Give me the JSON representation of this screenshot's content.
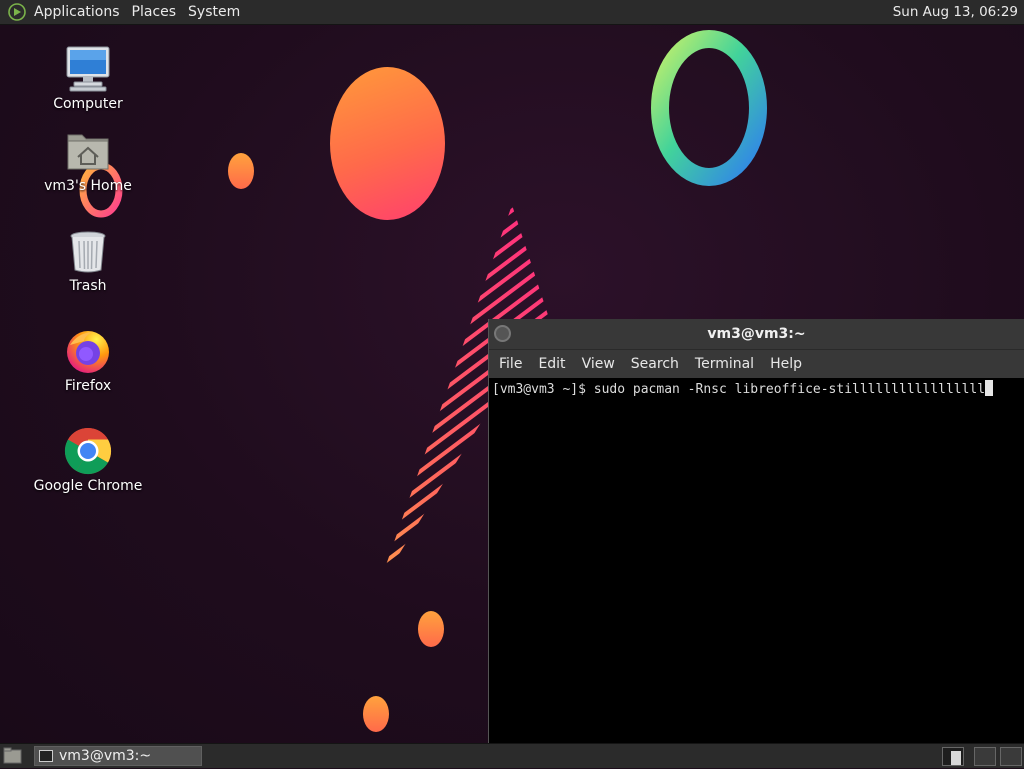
{
  "top_panel": {
    "menus": [
      "Applications",
      "Places",
      "System"
    ],
    "clock": "Sun Aug 13, 06:29"
  },
  "desktop": {
    "icons": [
      {
        "label": "Computer",
        "icon": "computer-icon"
      },
      {
        "label": "vm3's Home",
        "icon": "home-folder-icon"
      },
      {
        "label": "Trash",
        "icon": "trash-icon"
      },
      {
        "label": "Firefox",
        "icon": "firefox-icon"
      },
      {
        "label": "Google Chrome",
        "icon": "chrome-icon"
      }
    ]
  },
  "terminal": {
    "title": "vm3@vm3:~",
    "menu": [
      "File",
      "Edit",
      "View",
      "Search",
      "Terminal",
      "Help"
    ],
    "prompt": "[vm3@vm3 ~]$ ",
    "command": "sudo pacman -Rnsc libreoffice-stilllllllllllllllll"
  },
  "bottom_panel": {
    "tasks": [
      {
        "label": "vm3@vm3:~",
        "icon": "terminal-icon"
      }
    ]
  },
  "colors": {
    "panel": "#2b2b2b",
    "wallpaper": "#1f0c1d",
    "accent_orange": "#ff8a3d",
    "accent_pink": "#ff3f6e"
  }
}
